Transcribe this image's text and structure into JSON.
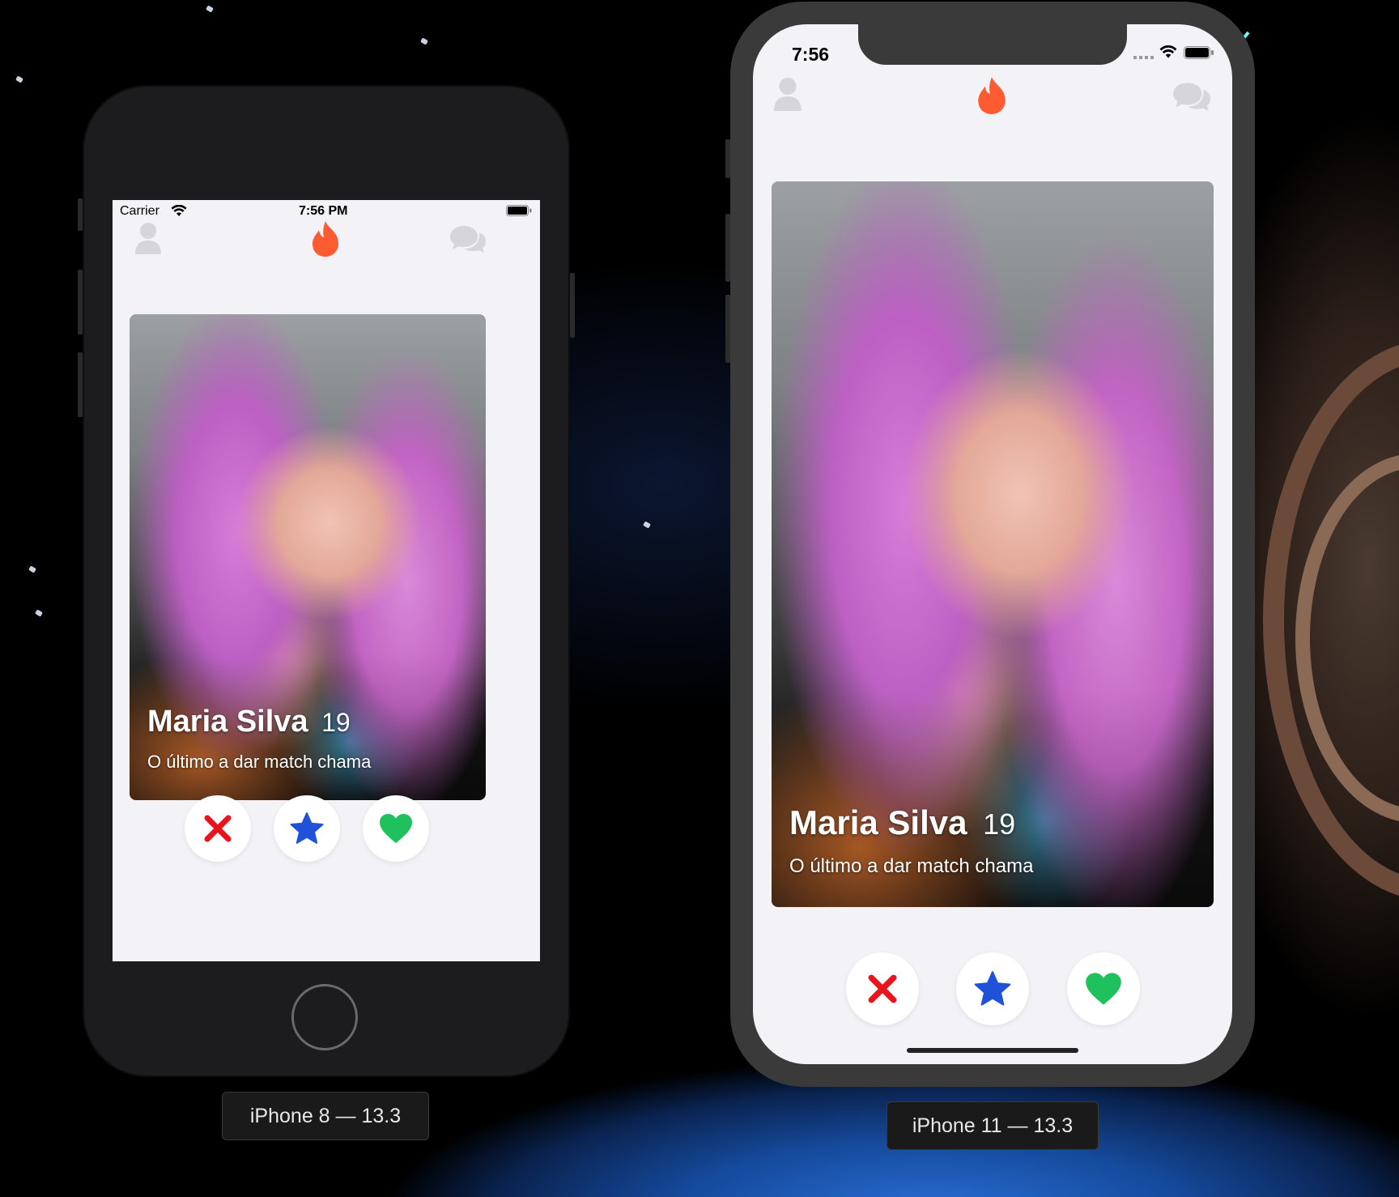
{
  "iphone8": {
    "label": "iPhone 8 — 13.3",
    "status_bar": {
      "carrier": "Carrier",
      "time": "7:56 PM"
    },
    "card": {
      "name": "Maria Silva",
      "age": "19",
      "bio": "O último a dar match chama"
    }
  },
  "iphone11": {
    "label": "iPhone 11 — 13.3",
    "status_bar": {
      "time": "7:56"
    },
    "card": {
      "name": "Maria Silva",
      "age": "19",
      "bio": "O último a dar match chama"
    }
  },
  "colors": {
    "flame": "#fd5b32",
    "dislike": "#e8141e",
    "superlike": "#1f52d8",
    "like": "#1fc15e",
    "header_icon": "#d6d6da",
    "screen_bg": "#f3f2f7"
  },
  "icons": [
    "profile-icon",
    "flame-icon",
    "chat-icon",
    "close-icon",
    "star-icon",
    "heart-icon",
    "wifi-icon",
    "battery-icon"
  ]
}
